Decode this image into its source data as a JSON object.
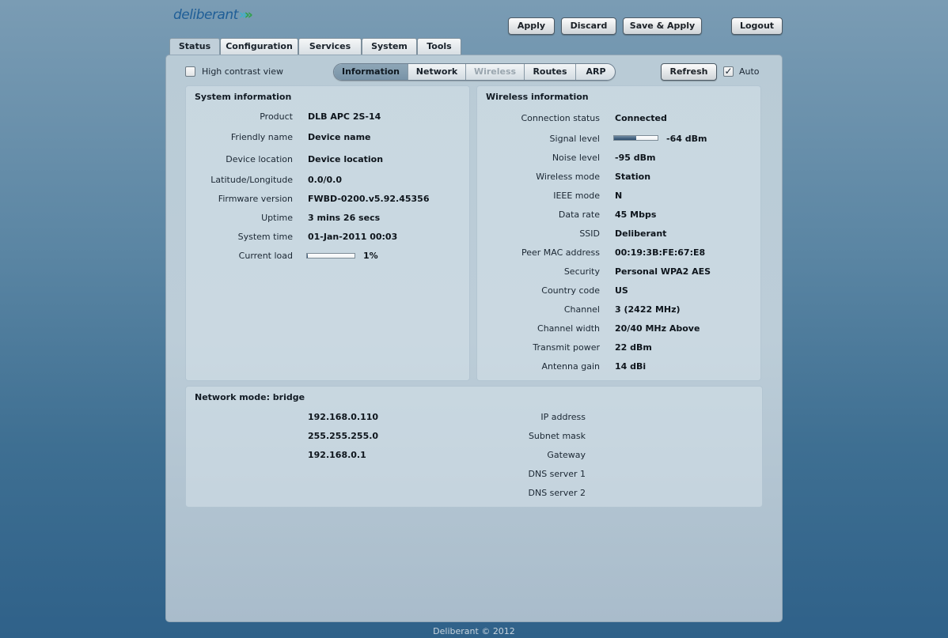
{
  "brand": {
    "logo_text": "deliberant",
    "logo_mark": "»"
  },
  "header_buttons": {
    "apply": "Apply",
    "discard": "Discard",
    "save_apply": "Save & Apply",
    "logout": "Logout"
  },
  "tabs": [
    {
      "label": "Status",
      "active": true
    },
    {
      "label": "Configuration",
      "active": false
    },
    {
      "label": "Services",
      "active": false
    },
    {
      "label": "System",
      "active": false
    },
    {
      "label": "Tools",
      "active": false
    }
  ],
  "toolbar": {
    "high_contrast_label": "High contrast view",
    "high_contrast_checked": false,
    "subtabs": [
      {
        "label": "Information",
        "state": "active"
      },
      {
        "label": "Network",
        "state": "normal"
      },
      {
        "label": "Wireless",
        "state": "disabled"
      },
      {
        "label": "Routes",
        "state": "normal"
      },
      {
        "label": "ARP",
        "state": "normal"
      }
    ],
    "refresh_label": "Refresh",
    "auto_label": "Auto",
    "auto_checked": true,
    "check_mark": "✓"
  },
  "system_info": {
    "title": "System information",
    "rows": [
      {
        "key": "Product",
        "value": "DLB APC 2S-14"
      },
      {
        "key": "Friendly name",
        "value": "Device name"
      },
      {
        "key": "Device location",
        "value": "Device location"
      },
      {
        "key": "Latitude/Longitude",
        "value": "0.0/0.0"
      },
      {
        "key": "Firmware version",
        "value": "FWBD-0200.v5.92.45356"
      },
      {
        "key": "Uptime",
        "value": "3 mins 26 secs"
      },
      {
        "key": "System time",
        "value": "01-Jan-2011 00:03"
      },
      {
        "key": "Current load",
        "value": "1%"
      }
    ],
    "current_load_fraction": 0.01
  },
  "wireless_info": {
    "title": "Wireless information",
    "rows": [
      {
        "key": "Connection status",
        "value": "Connected"
      },
      {
        "key": "Signal level",
        "value": "-64 dBm"
      },
      {
        "key": "Noise level",
        "value": "-95 dBm"
      },
      {
        "key": "Wireless mode",
        "value": "Station"
      },
      {
        "key": "IEEE mode",
        "value": "N"
      },
      {
        "key": "Data rate",
        "value": "45 Mbps"
      },
      {
        "key": "SSID",
        "value": "Deliberant"
      },
      {
        "key": "Peer MAC address",
        "value": "00:19:3B:FE:67:E8"
      },
      {
        "key": "Security",
        "value": "Personal WPA2 AES"
      },
      {
        "key": "Country code",
        "value": "US"
      },
      {
        "key": "Channel",
        "value": "3 (2422 MHz)"
      },
      {
        "key": "Channel width",
        "value": "20/40 MHz Above"
      },
      {
        "key": "Transmit power",
        "value": "22 dBm"
      },
      {
        "key": "Antenna gain",
        "value": "14 dBi"
      }
    ],
    "signal_level_fraction": 0.5
  },
  "network_info": {
    "title": "Network mode: bridge",
    "rows": [
      {
        "key": "IP address",
        "value": "192.168.0.110"
      },
      {
        "key": "Subnet mask",
        "value": "255.255.255.0"
      },
      {
        "key": "Gateway",
        "value": "192.168.0.1"
      },
      {
        "key": "DNS server 1",
        "value": ""
      },
      {
        "key": "DNS server 2",
        "value": ""
      }
    ]
  },
  "footer": {
    "text": "Deliberant © 2012"
  },
  "colors": {
    "background": "#4f7b9c",
    "panel": "#bccdd8",
    "active_subtab": "#7f99ac",
    "bar_fill": "#3a5a7a"
  }
}
